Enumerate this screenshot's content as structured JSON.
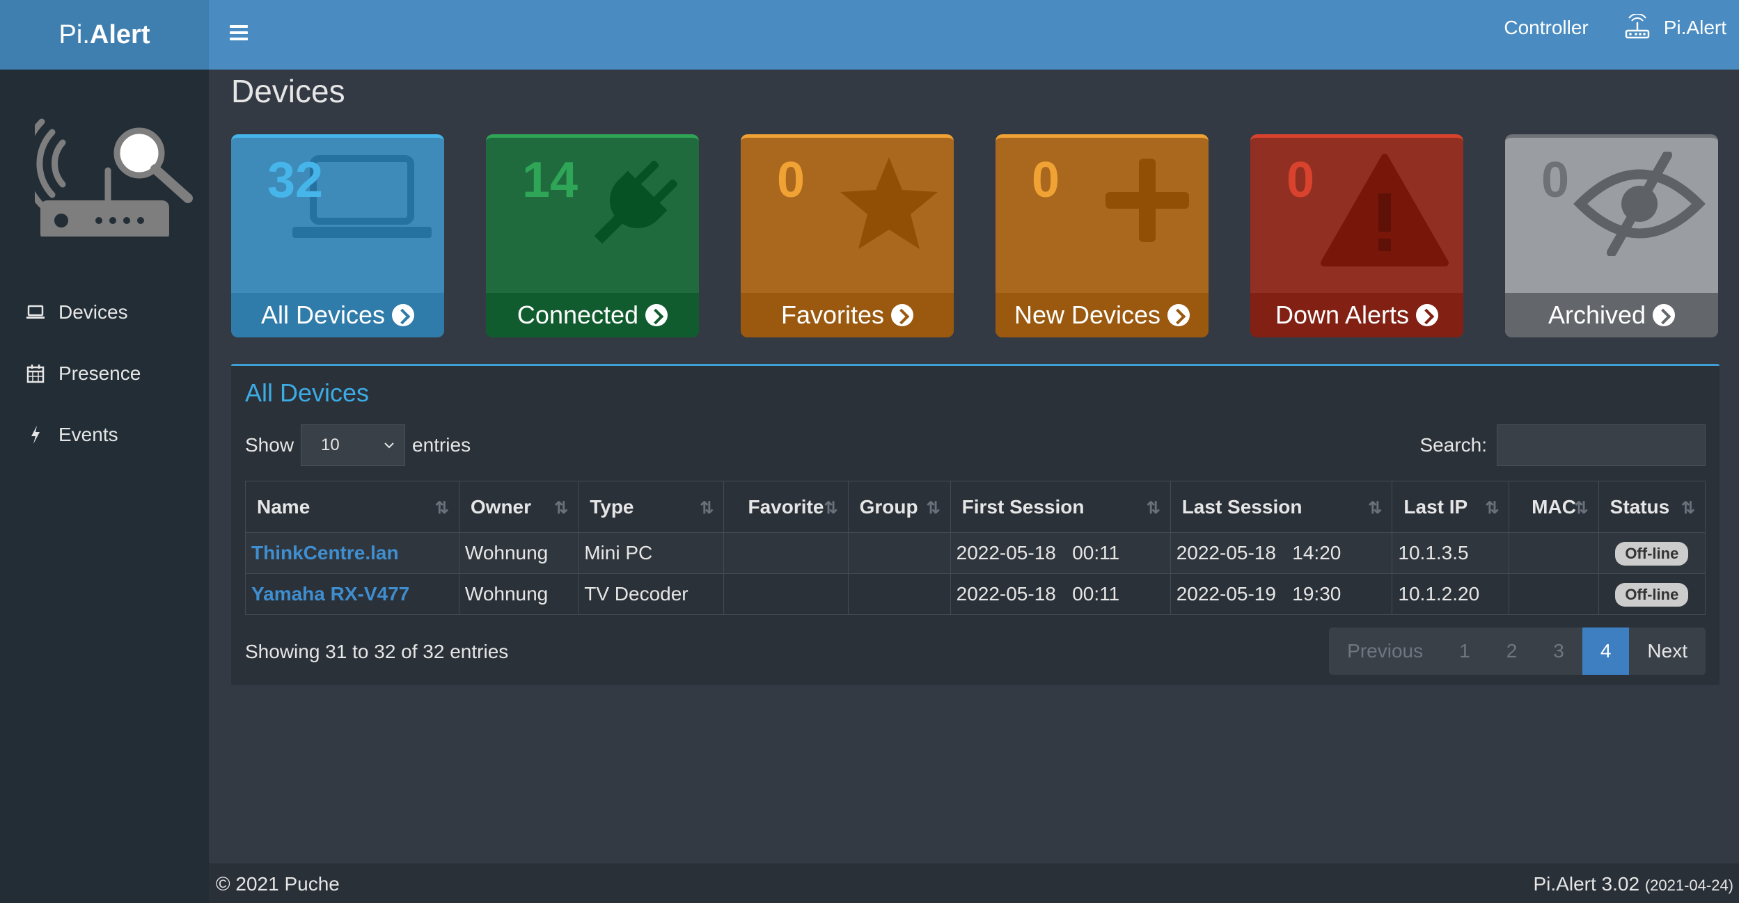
{
  "brand": {
    "prefix": "Pi.",
    "bold": "Alert"
  },
  "topbar": {
    "controller": "Controller",
    "user": "Pi.Alert"
  },
  "sidebar": {
    "items": [
      {
        "label": "Devices",
        "icon": "laptop-icon"
      },
      {
        "label": "Presence",
        "icon": "calendar-icon"
      },
      {
        "label": "Events",
        "icon": "bolt-icon"
      }
    ]
  },
  "page": {
    "title": "Devices"
  },
  "tiles": [
    {
      "count": "32",
      "label": "All Devices",
      "icon": "laptop-icon",
      "color": "#3e8ab8",
      "accent": "#46b5ea"
    },
    {
      "count": "14",
      "label": "Connected",
      "icon": "plug-icon",
      "color": "#1f6b3d",
      "accent": "#2fa557"
    },
    {
      "count": "0",
      "label": "Favorites",
      "icon": "star-icon",
      "color": "#a9681e",
      "accent": "#f0a234"
    },
    {
      "count": "0",
      "label": "New Devices",
      "icon": "plus-icon",
      "color": "#a9681e",
      "accent": "#f0a234"
    },
    {
      "count": "0",
      "label": "Down Alerts",
      "icon": "warning-icon",
      "color": "#902f22",
      "accent": "#d9432d"
    },
    {
      "count": "0",
      "label": "Archived",
      "icon": "eye-slash-icon",
      "color": "#9a9da2",
      "accent": "#6e7176"
    }
  ],
  "table_box": {
    "title": "All Devices",
    "show_label": "Show",
    "entries_value": "10",
    "entries_label": "entries",
    "search_label": "Search:",
    "search_value": "",
    "columns": [
      "Name",
      "Owner",
      "Type",
      "Favorite",
      "Group",
      "First Session",
      "Last Session",
      "Last IP",
      "MAC",
      "Status"
    ],
    "rows": [
      {
        "name": "ThinkCentre.lan",
        "owner": "Wohnung",
        "type": "Mini PC",
        "favorite": "",
        "group": "",
        "first_session": "2022-05-18   00:11",
        "last_session": "2022-05-18   14:20",
        "last_ip": "10.1.3.5",
        "mac": "",
        "status": "Off-line"
      },
      {
        "name": "Yamaha RX-V477",
        "owner": "Wohnung",
        "type": "TV Decoder",
        "favorite": "",
        "group": "",
        "first_session": "2022-05-18   00:11",
        "last_session": "2022-05-19   19:30",
        "last_ip": "10.1.2.20",
        "mac": "",
        "status": "Off-line"
      }
    ],
    "info": "Showing 31 to 32 of 32 entries",
    "pager": {
      "previous": "Previous",
      "pages": [
        "1",
        "2",
        "3",
        "4"
      ],
      "current": "4",
      "next": "Next"
    }
  },
  "footer": {
    "copyright": "© 2021 Puche",
    "version": "Pi.Alert  3.02",
    "date": "(2021-04-24)"
  }
}
